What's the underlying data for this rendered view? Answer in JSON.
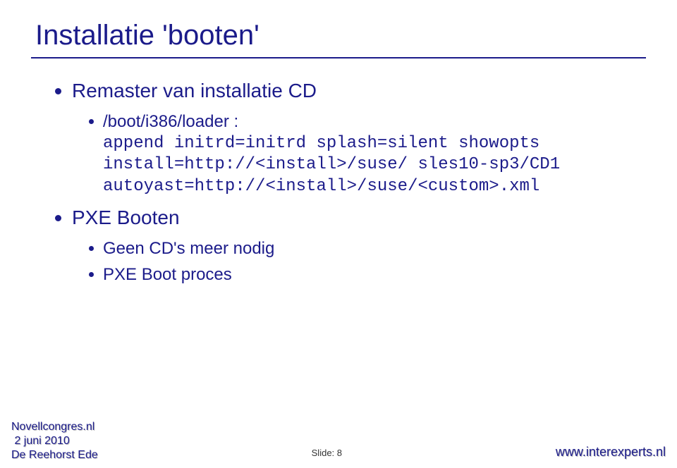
{
  "title": "Installatie 'booten'",
  "bullets": {
    "b1": {
      "label": "Remaster van installatie CD",
      "sub": {
        "s1": "/boot/i386/loader :",
        "mono1": "append initrd=initrd splash=silent showopts",
        "mono2": "install=http://<install>/suse/ sles10-sp3/CD1",
        "mono3": "autoyast=http://<install>/suse/<custom>.xml"
      }
    },
    "b2": {
      "label": "PXE Booten",
      "sub": {
        "s1": "Geen CD's meer nodig",
        "s2": "PXE Boot proces"
      }
    }
  },
  "footer": {
    "left_line1": "Novellcongres.nl",
    "left_line2": "2 juni 2010",
    "left_line3": "De Reehorst Ede",
    "center": "Slide: 8",
    "right": "www.interexperts.nl"
  }
}
